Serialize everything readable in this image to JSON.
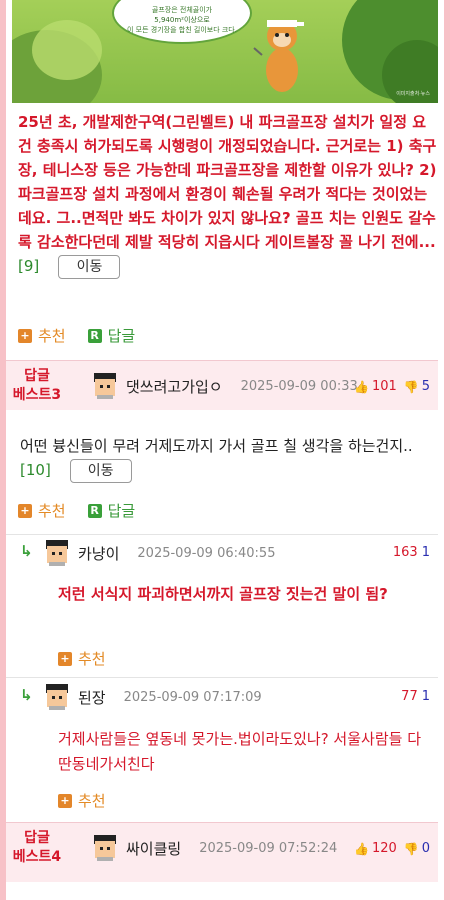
{
  "hero": {
    "bubble_line1": "골프장은 전체골이가",
    "bubble_line2": "5,940m²이상으로",
    "bubble_line3": "이 모든 경기장을 합친 길이보다 크다.",
    "credit": "이미지출처·뉴스"
  },
  "post": {
    "text": "25년 초, 개발제한구역(그린벨트) 내 파크골프장 설치가 일정 요건 충족시 허가되도록 시행령이 개정되었습니다. 근거로는 1) 축구장, 테니스장 등은 가능한데 파크골프장을 제한할 이유가 있나? 2) 파크골프장 설치 과정에서 환경이 훼손될 우려가 적다는 것이었는데요. 그..면적만 봐도 차이가 있지 않나요? 골프 치는 인원도 갈수록 감소한다던데 제발 적당히 지읍시다 게이트볼장 꼴 나기 전에...",
    "ref": "[9]",
    "move_label": "이동",
    "recommend_label": "추천",
    "reply_label": "답글"
  },
  "best3": {
    "tag_line1": "답글",
    "tag_line2": "베스트3",
    "nick": "댓쓰려고가입ㅇ",
    "date": "2025-09-09 00:33",
    "up": "101",
    "down": "5",
    "text": "어떤 븅신들이 무려 거제도까지 가서 골프 칠 생각을 하는건지..",
    "ref": "[10]",
    "move_label": "이동",
    "recommend_label": "추천",
    "reply_label": "답글"
  },
  "replies": [
    {
      "nick": "카냥이",
      "date": "2025-09-09 06:40:55",
      "up": "163",
      "down": "1",
      "text": "저런 서식지 파괴하면서까지 골프장 짓는건 말이 됨?",
      "recommend_label": "추천"
    },
    {
      "nick": "된장",
      "date": "2025-09-09 07:17:09",
      "up": "77",
      "down": "1",
      "text": "거제사람들은 옆동네 못가는.법이라도있나? 서울사람들 다 딴동네가서친다",
      "recommend_label": "추천"
    }
  ],
  "best4": {
    "tag_line1": "답글",
    "tag_line2": "베스트4",
    "nick": "싸이클링",
    "date": "2025-09-09 07:52:24",
    "up": "120",
    "down": "0"
  },
  "colors": {
    "accent_red": "#d5182b",
    "reply_green": "#3aa03a",
    "recommend_orange": "#e3862a",
    "downvote_blue": "#2a2fb0",
    "side_pink": "#f7c1c7"
  },
  "icons": [
    "plus-icon",
    "reply-r-icon",
    "thumb-up-icon",
    "thumb-down-icon",
    "reply-arrow-icon",
    "avatar-icon"
  ]
}
